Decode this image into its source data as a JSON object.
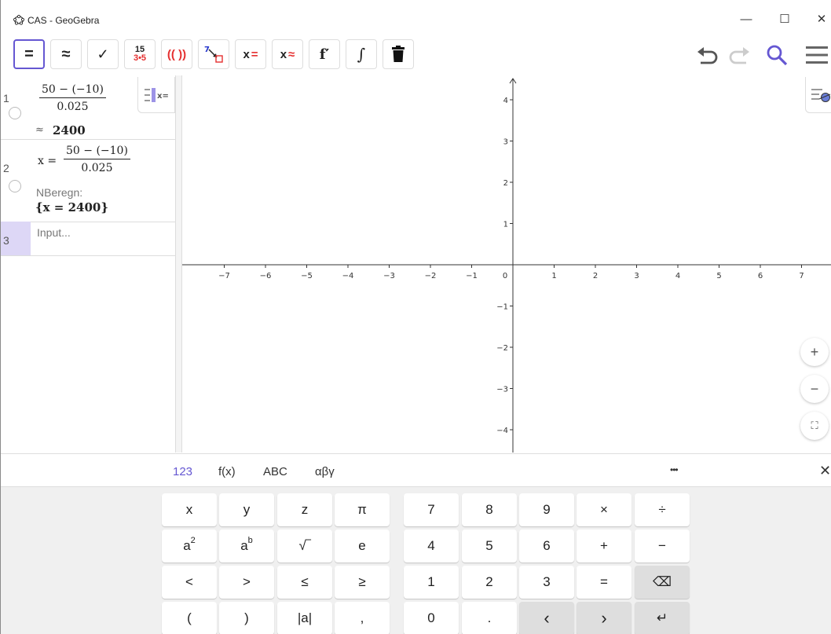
{
  "window": {
    "title": "CAS - GeoGebra",
    "minimize": "—",
    "maximize": "☐",
    "close": "✕"
  },
  "toolbar": {
    "eval_exact": "=",
    "eval_numeric": "≈",
    "keep_input": "✓",
    "factor_top": "15",
    "factor_bottom": "3•5",
    "expand": "(( ))",
    "substitute_num": "7",
    "solve_label": "x",
    "solve_eq": "=",
    "nsolve_label": "x",
    "nsolve_eq": "≈",
    "derivative": "f′",
    "integral": "∫"
  },
  "cas": {
    "rows": [
      {
        "num": "1",
        "frac_num": "50 − (−10)",
        "frac_den": "0.025",
        "result_prefix": "≈",
        "result": "2400"
      },
      {
        "num": "2",
        "prefix": "x =",
        "frac_num": "50 − (−10)",
        "frac_den": "0.025",
        "label": "NBeregn:",
        "result": "{x = 2400}"
      }
    ],
    "input_num": "3",
    "input_placeholder": "Input..."
  },
  "graphics": {
    "x_ticks": [
      "−7",
      "−6",
      "−5",
      "−4",
      "−3",
      "−2",
      "−1",
      "1",
      "2",
      "3",
      "4",
      "5",
      "6",
      "7"
    ],
    "y_ticks": [
      "4",
      "3",
      "2",
      "1",
      "−1",
      "−2",
      "−3",
      "−4"
    ],
    "origin": "0",
    "zoom_in": "+",
    "zoom_out": "−",
    "fullscreen": "⛶"
  },
  "keyboard": {
    "tabs": [
      "123",
      "f(x)",
      "ABC",
      "αβγ"
    ],
    "more": "•••",
    "close": "✕",
    "left_keys": [
      [
        "x",
        "y",
        "z",
        "π"
      ],
      [
        "a",
        "a",
        "√‾",
        "e"
      ],
      [
        "<",
        ">",
        "≤",
        "≥"
      ],
      [
        "(",
        ")",
        "|a|",
        ","
      ]
    ],
    "sup_a2": "2",
    "sup_ab": "b",
    "right_keys": [
      [
        "7",
        "8",
        "9",
        "×",
        "÷"
      ],
      [
        "4",
        "5",
        "6",
        "+",
        "−"
      ],
      [
        "1",
        "2",
        "3",
        "=",
        "⌫"
      ],
      [
        "0",
        ".",
        "‹",
        "›",
        "↵"
      ]
    ]
  },
  "colors": {
    "accent": "#6557d2",
    "red": "#e53030",
    "input_bg": "#ddd7f6"
  }
}
